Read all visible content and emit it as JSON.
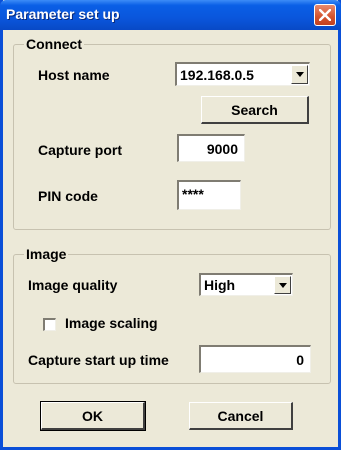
{
  "window": {
    "title": "Parameter set up",
    "close_icon": "close-icon"
  },
  "connect": {
    "group_label": "Connect",
    "host_name_label": "Host name",
    "host_name_value": "192.168.0.5",
    "search_label": "Search",
    "capture_port_label": "Capture port",
    "capture_port_value": "9000",
    "pin_label": "PIN code",
    "pin_value": "****"
  },
  "image": {
    "group_label": "Image",
    "quality_label": "Image quality",
    "quality_value": "High",
    "scaling_label": "Image scaling",
    "scaling_checked": false,
    "startup_label": "Capture start up time",
    "startup_value": "0"
  },
  "buttons": {
    "ok_label": "OK",
    "cancel_label": "Cancel"
  },
  "colors": {
    "titlebar": "#0a56dc",
    "dialog_bg": "#ece9d8",
    "close_button": "#d4532e"
  }
}
